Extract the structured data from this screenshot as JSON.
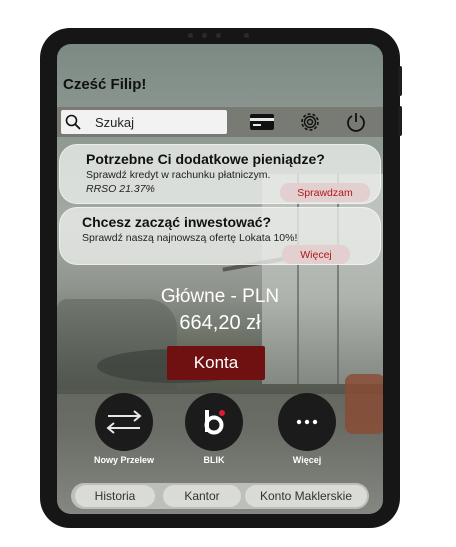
{
  "greeting": "Cześć Filip!",
  "search": {
    "placeholder": "Szukaj"
  },
  "toolbar_icons": [
    "card-icon",
    "gear-icon",
    "power-icon"
  ],
  "offers": [
    {
      "title": "Potrzebne Ci dodatkowe pieniądze?",
      "text": "Sprawdź kredyt w rachunku płatniczym.",
      "note": "RRSO 21.37%",
      "button": "Sprawdzam"
    },
    {
      "title": "Chcesz zacząć inwestować?",
      "text": "Sprawdź naszą najnowszą ofertę Lokata 10%!",
      "button": "Więcej"
    }
  ],
  "account": {
    "name": "Główne - PLN",
    "balance": "664,20 zł",
    "button": "Konta"
  },
  "actions": [
    {
      "label": "Nowy Przelew",
      "icon": "transfer-icon"
    },
    {
      "label": "BLIK",
      "icon": "blik-icon"
    },
    {
      "label": "Więcej",
      "icon": "more-icon"
    }
  ],
  "tabs": [
    "Historia",
    "Kantor",
    "Konto Maklerskie"
  ],
  "colors": {
    "accent": "#6f1111",
    "link_red": "#b01818",
    "pill_bg": "#e3cfcf",
    "action_bg": "#1b1b1b"
  }
}
